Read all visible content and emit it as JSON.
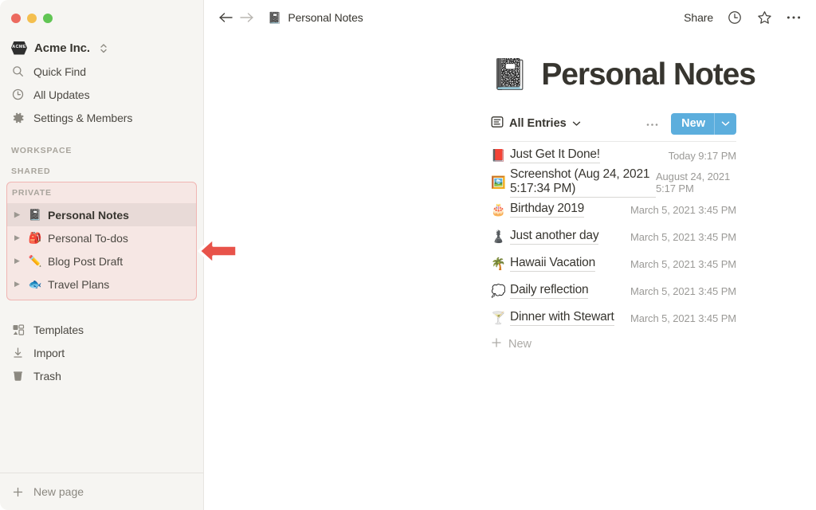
{
  "window": {
    "traffic_lights": [
      "close-button",
      "minimize-button",
      "maximize-button"
    ]
  },
  "sidebar": {
    "workspace": {
      "name": "Acme Inc.",
      "badge_text": "ACME"
    },
    "nav": [
      {
        "icon": "search-icon",
        "label": "Quick Find"
      },
      {
        "icon": "clock-icon",
        "label": "All Updates"
      },
      {
        "icon": "gear-icon",
        "label": "Settings & Members"
      }
    ],
    "sections": [
      {
        "id": "workspace",
        "label": "WORKSPACE",
        "items": []
      },
      {
        "id": "shared",
        "label": "SHARED",
        "items": []
      }
    ],
    "private": {
      "label": "PRIVATE",
      "highlighted": true,
      "highlight_color": "#F0B5B2",
      "items": [
        {
          "emoji": "📓",
          "label": "Personal Notes",
          "selected": true
        },
        {
          "emoji": "🎒",
          "label": "Personal To-dos",
          "selected": false
        },
        {
          "emoji": "✏️",
          "label": "Blog Post Draft",
          "selected": false
        },
        {
          "emoji": "🐟",
          "label": "Travel Plans",
          "selected": false
        }
      ]
    },
    "lower_nav": [
      {
        "icon": "templates-icon",
        "label": "Templates"
      },
      {
        "icon": "import-icon",
        "label": "Import"
      },
      {
        "icon": "trash-icon",
        "label": "Trash"
      }
    ],
    "footer": {
      "icon": "plus-icon",
      "label": "New page"
    }
  },
  "topbar": {
    "back_icon": "arrow-left-icon",
    "forward_icon": "arrow-right-icon",
    "breadcrumb_emoji": "📓",
    "breadcrumb": "Personal Notes",
    "share_label": "Share",
    "icons": [
      "clock-icon",
      "star-icon",
      "more-icon"
    ]
  },
  "page": {
    "emoji": "📓",
    "title": "Personal Notes"
  },
  "toolbar": {
    "view_icon": "list-view-icon",
    "view_label": "All Entries",
    "more_icon": "more-icon",
    "new_label": "New",
    "new_color": "#5CAEDD"
  },
  "entries": [
    {
      "emoji": "📕",
      "title": "Just Get It Done!",
      "date": "Today 9:17 PM"
    },
    {
      "emoji": "🖼️",
      "title": "Screenshot (Aug 24, 2021 5:17:34 PM)",
      "date": "August 24, 2021 5:17 PM"
    },
    {
      "emoji": "🎂",
      "title": "Birthday 2019",
      "date": "March 5, 2021 3:45 PM"
    },
    {
      "emoji": "♟️",
      "title": "Just another day",
      "date": "March 5, 2021 3:45 PM"
    },
    {
      "emoji": "🌴",
      "title": "Hawaii Vacation",
      "date": "March 5, 2021 3:45 PM"
    },
    {
      "emoji": "💭",
      "title": "Daily reflection",
      "date": "March 5, 2021 3:45 PM"
    },
    {
      "emoji": "🍸",
      "title": "Dinner with Stewart",
      "date": "March 5, 2021 3:45 PM"
    }
  ],
  "new_entry_row": {
    "icon": "plus-icon",
    "label": "New"
  },
  "annotation": {
    "type": "arrow-left",
    "color": "#E8534A"
  }
}
